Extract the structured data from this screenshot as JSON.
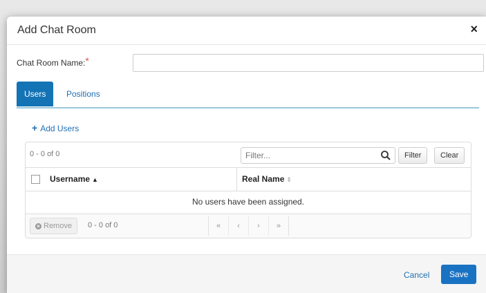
{
  "dialog": {
    "title": "Add Chat Room",
    "close_glyph": "×",
    "close_icon": "close-icon"
  },
  "form": {
    "name_label": "Chat Room Name:",
    "required_mark": "*",
    "name_value": "",
    "name_placeholder": ""
  },
  "tabs": [
    {
      "label": "Users",
      "active": true
    },
    {
      "label": "Positions",
      "active": false
    }
  ],
  "add_users": {
    "icon": "plus-icon",
    "label": "Add Users"
  },
  "grid": {
    "count_top": "0 - 0 of 0",
    "filter_placeholder": "Filter...",
    "filter_value": "",
    "search_icon": "search-icon",
    "filter_button": "Filter",
    "clear_button": "Clear",
    "columns": [
      {
        "label": "Username",
        "sort": "ascending"
      },
      {
        "label": "Real Name",
        "sort": "none"
      }
    ],
    "empty_message": "No users have been assigned.",
    "remove_button": "Remove",
    "count_bottom": "0 - 0 of 0",
    "pager": [
      "«",
      "‹",
      "›",
      "»"
    ]
  },
  "footer": {
    "cancel_label": "Cancel",
    "save_label": "Save"
  },
  "colors": {
    "accent": "#1473b5",
    "link": "#1f6fb2",
    "required": "#d9534f",
    "save_button": "#1a72c2"
  }
}
